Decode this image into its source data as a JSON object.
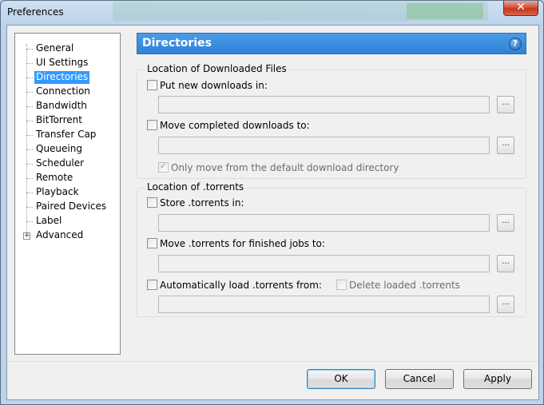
{
  "window": {
    "title": "Preferences",
    "close_glyph": "✕"
  },
  "sidebar": {
    "items": [
      {
        "label": "General"
      },
      {
        "label": "UI Settings"
      },
      {
        "label": "Directories",
        "selected": true
      },
      {
        "label": "Connection"
      },
      {
        "label": "Bandwidth"
      },
      {
        "label": "BitTorrent"
      },
      {
        "label": "Transfer Cap"
      },
      {
        "label": "Queueing"
      },
      {
        "label": "Scheduler"
      },
      {
        "label": "Remote"
      },
      {
        "label": "Playback"
      },
      {
        "label": "Paired Devices"
      },
      {
        "label": "Label"
      },
      {
        "label": "Advanced",
        "expandable": true
      }
    ],
    "expander_glyph": "+"
  },
  "panel": {
    "title": "Directories",
    "help_glyph": "?"
  },
  "downloads_group": {
    "title": "Location of Downloaded Files",
    "put_new": {
      "label": "Put new downloads in:",
      "checked": false,
      "value": ""
    },
    "move_completed": {
      "label": "Move completed downloads to:",
      "checked": false,
      "value": ""
    },
    "only_move_default": {
      "label": "Only move from the default download directory",
      "checked": true,
      "disabled": true
    },
    "browse_label": "..."
  },
  "torrents_group": {
    "title": "Location of .torrents",
    "store": {
      "label": "Store .torrents in:",
      "checked": false,
      "value": ""
    },
    "move_finished": {
      "label": "Move .torrents for finished jobs to:",
      "checked": false,
      "value": ""
    },
    "auto_load": {
      "label": "Automatically load .torrents from:",
      "checked": false,
      "value": ""
    },
    "delete_loaded": {
      "label": "Delete loaded .torrents",
      "checked": false,
      "disabled": true
    },
    "browse_label": "..."
  },
  "buttons": {
    "ok": "OK",
    "cancel": "Cancel",
    "apply": "Apply"
  },
  "colors": {
    "header_blue": "#2f82d6",
    "selection_blue": "#3399ff"
  }
}
